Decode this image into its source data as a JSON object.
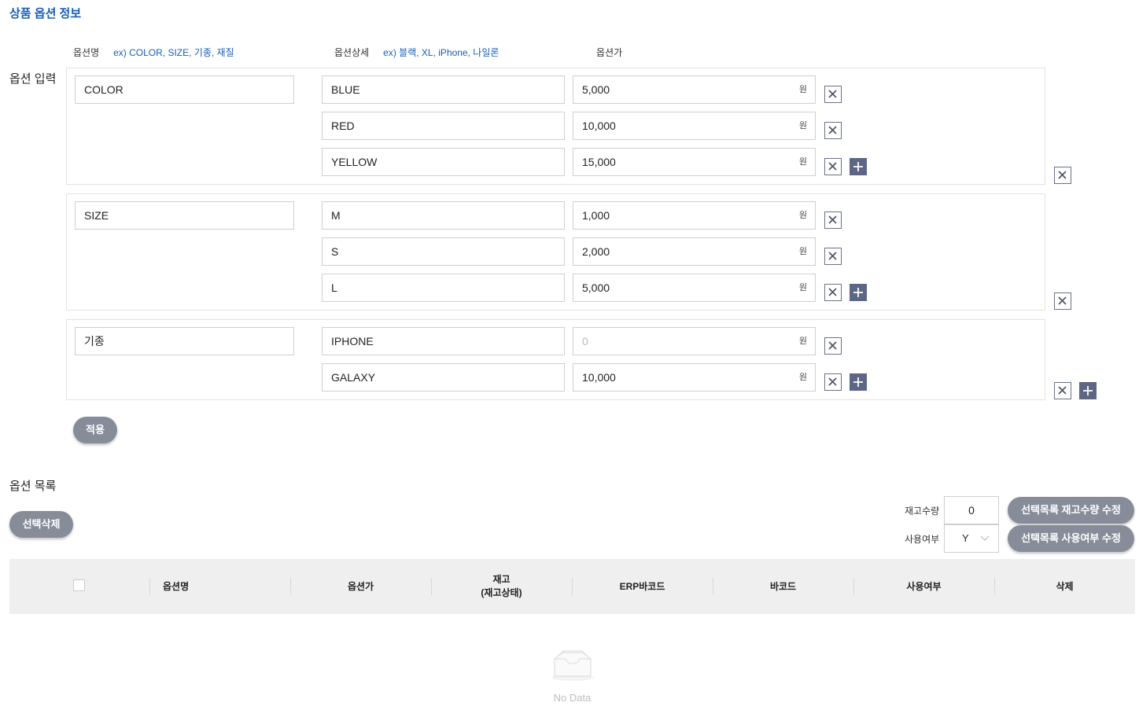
{
  "page": {
    "title": "상품 옵션 정보"
  },
  "option_input": {
    "section_label": "옵션 입력",
    "headers": {
      "name": "옵션명",
      "name_example": "ex) COLOR, SIZE, 기종, 재질",
      "detail": "옵션상세",
      "detail_example": "ex) 블랙, XL, iPhone, 나일론",
      "price": "옵션가"
    },
    "currency_unit": "원",
    "groups": [
      {
        "name": "COLOR",
        "items": [
          {
            "detail": "BLUE",
            "price": "5,000"
          },
          {
            "detail": "RED",
            "price": "10,000"
          },
          {
            "detail": "YELLOW",
            "price": "15,000"
          }
        ]
      },
      {
        "name": "SIZE",
        "items": [
          {
            "detail": "M",
            "price": "1,000"
          },
          {
            "detail": "S",
            "price": "2,000"
          },
          {
            "detail": "L",
            "price": "5,000"
          }
        ]
      },
      {
        "name": "기종",
        "items": [
          {
            "detail": "IPHONE",
            "price": "",
            "price_placeholder": "0"
          },
          {
            "detail": "GALAXY",
            "price": "10,000"
          }
        ]
      }
    ],
    "apply_label": "적용"
  },
  "option_list": {
    "section_label": "옵션 목록",
    "delete_selected_label": "선택삭제",
    "stock_label": "재고수량",
    "stock_value": "0",
    "use_label": "사용여부",
    "use_value": "Y",
    "update_stock_label": "선택목록 재고수량 수정",
    "update_use_label": "선택목록 사용여부 수정",
    "columns": [
      "옵션명",
      "옵션가",
      "재고\n(재고상태)",
      "ERP바코드",
      "바코드",
      "사용여부",
      "삭제"
    ],
    "empty_text": "No Data"
  },
  "icons": {
    "remove": "close-box-icon",
    "add": "plus-box-icon",
    "empty": "inbox-icon",
    "dropdown": "chevron-down-icon"
  },
  "colors": {
    "accent": "#1a5fb4",
    "button": "#868d99",
    "icon_button": "#5d6685"
  }
}
